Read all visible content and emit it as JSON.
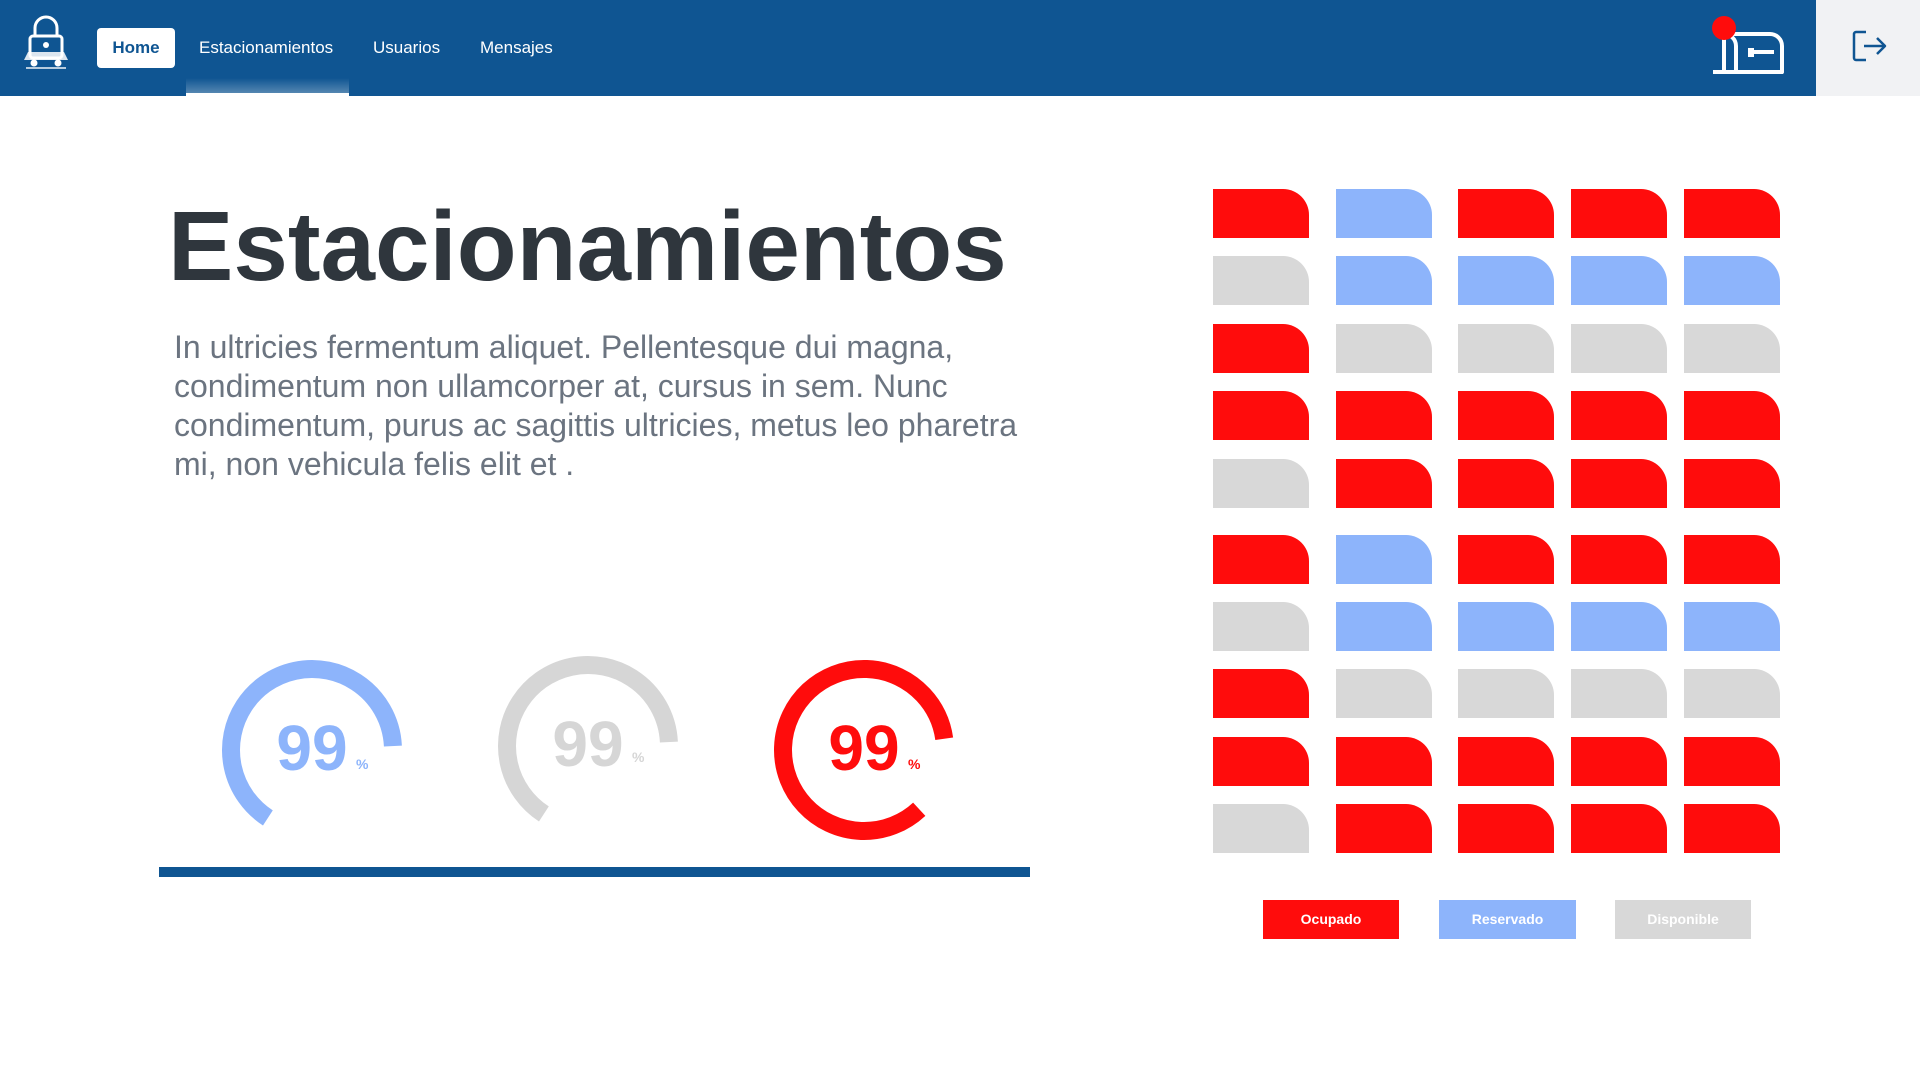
{
  "header": {
    "nav": [
      {
        "label": "Home",
        "active": true
      },
      {
        "label": "Estacionamientos",
        "active": false
      },
      {
        "label": "Usuarios",
        "active": false
      },
      {
        "label": "Mensajes",
        "active": false
      }
    ],
    "icons": {
      "logo": "lock-car-logo",
      "mail": "mailbox-icon",
      "logout": "logout-icon"
    }
  },
  "main": {
    "title": "Estacionamientos",
    "description": "In ultricies fermentum aliquet. Pellentesque dui magna, condimentum non ullamcorper at, cursus in sem. Nunc condimentum, purus ac sagittis ultricies, metus leo pharetra mi, non vehicula felis elit et ."
  },
  "gauges": [
    {
      "value": "99",
      "unit": "%",
      "color": "#8db4fb"
    },
    {
      "value": "99",
      "unit": "%",
      "color": "#d6d6d6"
    },
    {
      "value": "99",
      "unit": "%",
      "color": "#ff0c0c"
    }
  ],
  "parking": {
    "grid_top": [
      [
        "o",
        "r",
        "o",
        "o",
        "o"
      ],
      [
        "d",
        "r",
        "r",
        "r",
        "r"
      ],
      [
        "o",
        "d",
        "d",
        "d",
        "d"
      ],
      [
        "o",
        "o",
        "o",
        "o",
        "o"
      ],
      [
        "d",
        "o",
        "o",
        "o",
        "o"
      ]
    ],
    "grid_bottom": [
      [
        "o",
        "r",
        "o",
        "o",
        "o"
      ],
      [
        "d",
        "r",
        "r",
        "r",
        "r"
      ],
      [
        "o",
        "d",
        "d",
        "d",
        "d"
      ],
      [
        "o",
        "o",
        "o",
        "o",
        "o"
      ],
      [
        "d",
        "o",
        "o",
        "o",
        "o"
      ]
    ]
  },
  "legend": {
    "occupied": "Ocupado",
    "reserved": "Reservado",
    "available": "Disponible"
  },
  "colors": {
    "brand": "#0f5592",
    "occupied": "#ff0c0c",
    "reserved": "#8db4fb",
    "available": "#d8d8d8"
  }
}
